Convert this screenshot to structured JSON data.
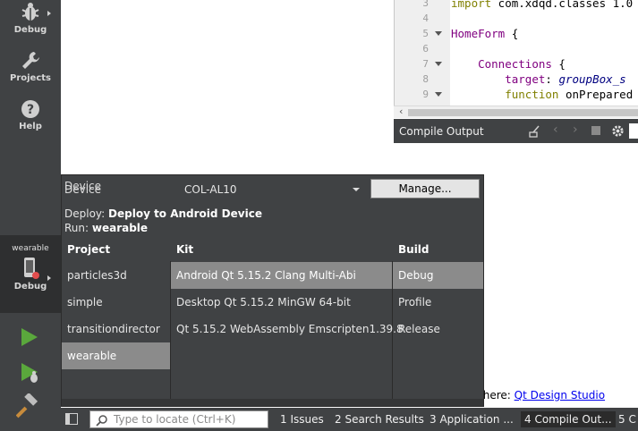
{
  "sidebar": {
    "modes": [
      {
        "label": "Debug",
        "icon": "debug-icon"
      },
      {
        "label": "Projects",
        "icon": "wrench-icon"
      },
      {
        "label": "Help",
        "icon": "help-icon"
      }
    ],
    "kit_selector": {
      "project": "wearable",
      "label": "Debug"
    }
  },
  "editor": {
    "lines": [
      {
        "num": "3",
        "text": "import com.xdqd.classes 1.0",
        "fold": false
      },
      {
        "num": "4",
        "text": "",
        "fold": false
      },
      {
        "num": "5",
        "text": "HomeForm {",
        "fold": true
      },
      {
        "num": "6",
        "text": "",
        "fold": false
      },
      {
        "num": "7",
        "text": "    Connections {",
        "fold": true
      },
      {
        "num": "8",
        "text": "        target: groupBox_s",
        "fold": false
      },
      {
        "num": "9",
        "text": "        function onPrepared",
        "fold": true
      }
    ]
  },
  "output": {
    "title": "Compile Output",
    "studio_text": "udio here: ",
    "studio_link": "Qt Design Studio"
  },
  "popup": {
    "device_label_a": "Device",
    "device_label_b": "Device",
    "device_value": "COL-AL10",
    "manage_label": "Manage...",
    "deploy_prefix": "Deploy: ",
    "deploy_value": "Deploy to Android Device",
    "run_prefix": "Run: ",
    "run_value": "wearable",
    "headers": {
      "project": "Project",
      "kit": "Kit",
      "build": "Build"
    },
    "projects": [
      "particles3d",
      "simple",
      "transitiondirector",
      "wearable"
    ],
    "kits": [
      "Android Qt 5.15.2 Clang Multi-Abi",
      "Desktop Qt 5.15.2 MinGW 64-bit",
      "Qt 5.15.2 WebAssembly Emscripten1.39.8"
    ],
    "builds": [
      "Debug",
      "Profile",
      "Release"
    ]
  },
  "statusbar": {
    "locate_placeholder": "Type to locate (Ctrl+K)",
    "panes": [
      "1  Issues",
      "2  Search Results",
      "3  Application ...",
      "4  Compile Out...",
      "5  C"
    ]
  },
  "colors": {
    "sidebar_bg": "#404244",
    "selection": "#8b8b8b",
    "run_green": "#5aa83c",
    "link": "#0000ee"
  }
}
